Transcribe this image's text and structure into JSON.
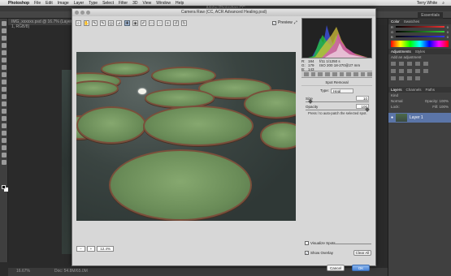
{
  "menubar": {
    "app": "Photoshop",
    "items": [
      "File",
      "Edit",
      "Image",
      "Layer",
      "Type",
      "Select",
      "Filter",
      "3D",
      "View",
      "Window",
      "Help"
    ],
    "user": "Terry White",
    "window_title": "Adobe Photoshop CC"
  },
  "options_bar": {
    "workspace": "Essentials"
  },
  "document": {
    "tab": "IMG_xxxxxx.psd @ 16.7% (Layer 1, RGB/8)",
    "status_zoom": "16.67%",
    "status_doc": "Doc: 54.8M/65.0M"
  },
  "acr": {
    "title": "Camera Raw (CC, ACR Advanced Healing.psd)",
    "preview_label": "Preview",
    "readout": {
      "r_label": "R:",
      "r": "184",
      "g_label": "G:",
      "g": "179",
      "b_label": "B:",
      "b": "143",
      "line1": "f/11   1/1250 s",
      "line2": "ISO 200   18-270@27 mm"
    },
    "panel_title": "Spot Removal",
    "type_label": "Type:",
    "type_value": "Heal",
    "size_label": "Size",
    "size_value": "10",
    "size_level": 0.08,
    "opacity_label": "Opacity",
    "opacity_value": "100",
    "opacity_level": 1.0,
    "hint": "Press / to auto-patch the selected spot.",
    "visualize_label": "Visualize Spots",
    "overlay_label": "Show Overlay",
    "clear_label": "Clear All",
    "zoom_value": "12.4%",
    "cancel_label": "Cancel",
    "ok_label": "OK"
  },
  "right_panel": {
    "tabs1": [
      "Color",
      "Swatches"
    ],
    "color_rows": [
      {
        "label": "R",
        "value": "0"
      },
      {
        "label": "G",
        "value": "0"
      },
      {
        "label": "B",
        "value": "0"
      }
    ],
    "tabs2": [
      "Adjustments",
      "Styles"
    ],
    "add_adjustment": "Add an adjustment",
    "tabs3": [
      "Layers",
      "Channels",
      "Paths"
    ],
    "kind_label": "Kind",
    "blend": "Normal",
    "opacity_label": "Opacity: 100%",
    "lock_label": "Lock:",
    "fill_label": "Fill: 100%",
    "layer_name": "Layer 1"
  }
}
